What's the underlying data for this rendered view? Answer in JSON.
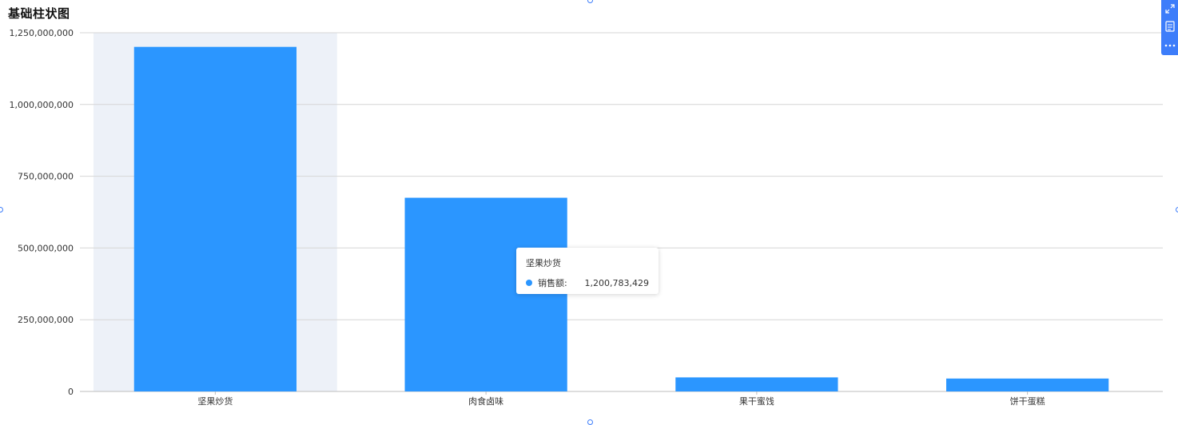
{
  "title": "基础柱状图",
  "chart_data": {
    "type": "bar",
    "categories": [
      "坚果炒货",
      "肉食卤味",
      "果干蜜饯",
      "饼干蛋糕"
    ],
    "series": [
      {
        "name": "销售额",
        "values": [
          1200783429,
          675000000,
          49000000,
          45000000
        ]
      }
    ],
    "ylim": [
      0,
      1250000000
    ],
    "yticks": [
      0,
      250000000,
      500000000,
      750000000,
      1000000000,
      1250000000
    ],
    "grid": true,
    "highlighted_category": "坚果炒货"
  },
  "tooltip": {
    "title": "坚果炒货",
    "series_name": "销售额:",
    "value": "1,200,783,429"
  },
  "colors": {
    "bar": "#2b96ff",
    "highlight_band": "#edf1f8",
    "gridline": "#d6d6d6",
    "toolbar": "#3d7dfa"
  },
  "toolbar": {
    "icons": [
      "expand-icon",
      "data-view-icon",
      "more-icon"
    ]
  }
}
